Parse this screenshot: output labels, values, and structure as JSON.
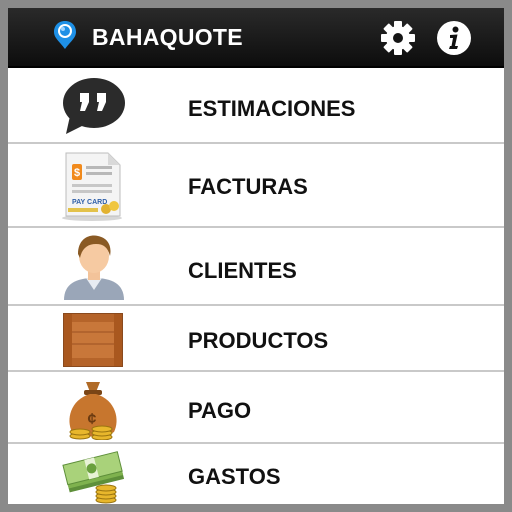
{
  "app": {
    "title": "BAHAQUOTE",
    "logo_icon": "map-pin-logo-icon",
    "settings_icon": "gear-icon",
    "info_icon": "info-icon"
  },
  "menu": {
    "items": [
      {
        "label": "ESTIMACIONES",
        "icon": "quote-bubble-icon"
      },
      {
        "label": "FACTURAS",
        "icon": "invoice-document-icon",
        "icon_text": "PAY CARD"
      },
      {
        "label": "CLIENTES",
        "icon": "client-person-icon"
      },
      {
        "label": "PRODUCTOS",
        "icon": "wooden-crate-icon"
      },
      {
        "label": "PAGO",
        "icon": "money-bag-icon"
      },
      {
        "label": "GASTOS",
        "icon": "cash-stack-icon"
      }
    ]
  },
  "colors": {
    "appbar": "#111111",
    "accent_blue": "#1e90e6",
    "divider": "#c9c9c9"
  }
}
